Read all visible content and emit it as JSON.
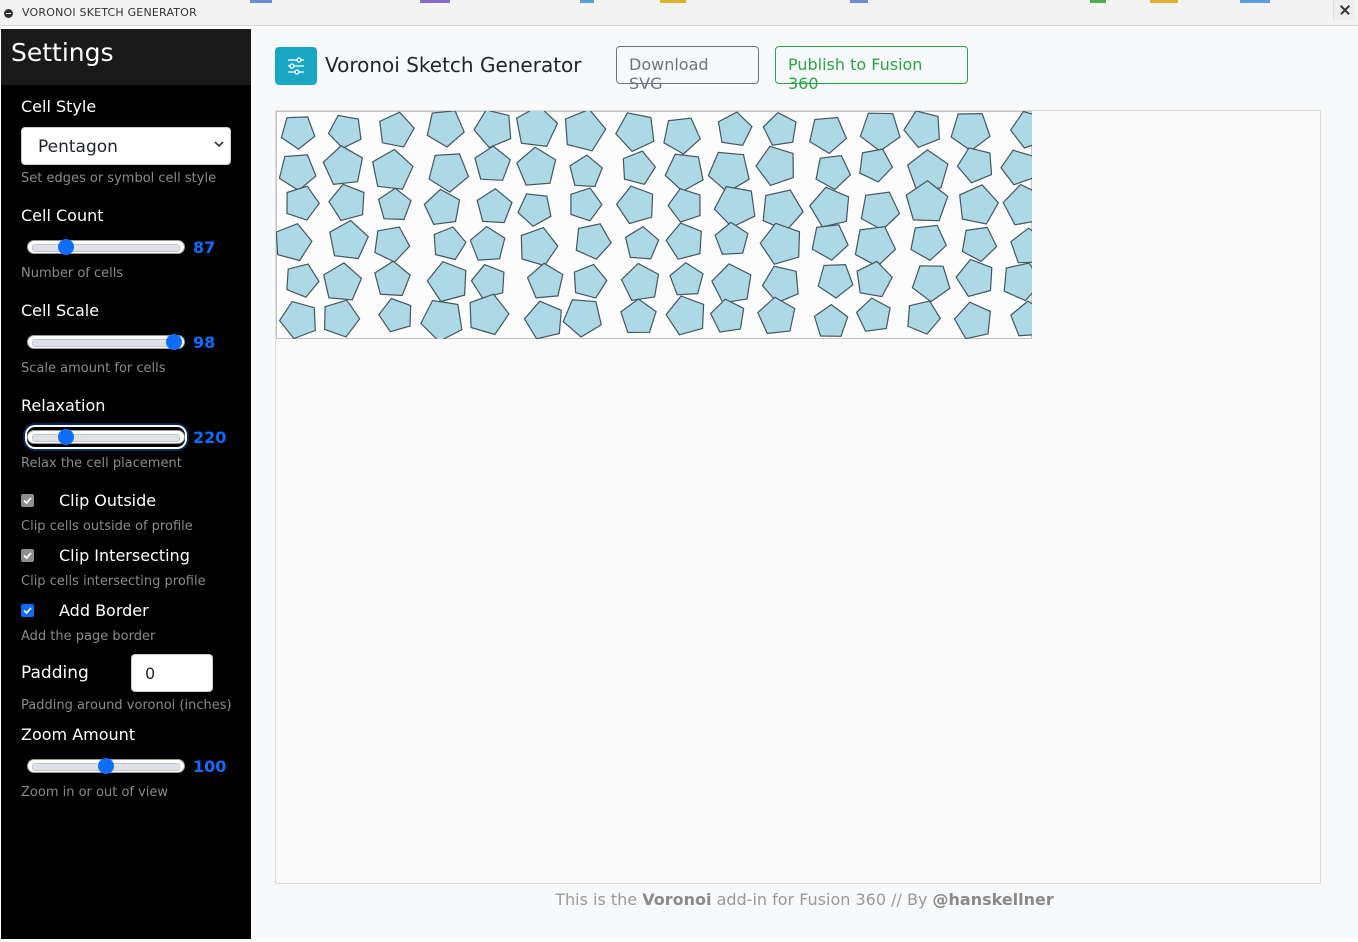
{
  "window": {
    "title": "VORONOI SKETCH GENERATOR"
  },
  "sidebar": {
    "title": "Settings",
    "cell_style": {
      "label": "Cell Style",
      "value": "Pentagon",
      "help": "Set edges or symbol cell style"
    },
    "cell_count": {
      "label": "Cell Count",
      "value": "87",
      "fraction": 0.22,
      "help": "Number of cells"
    },
    "cell_scale": {
      "label": "Cell Scale",
      "value": "98",
      "fraction": 0.98,
      "help": "Scale amount for cells"
    },
    "relaxation": {
      "label": "Relaxation",
      "value": "220",
      "fraction": 0.22,
      "help": "Relax the cell placement"
    },
    "clip_outside": {
      "label": "Clip Outside",
      "checked": true,
      "enabled": false,
      "help": "Clip cells outside of profile"
    },
    "clip_intersecting": {
      "label": "Clip Intersecting",
      "checked": true,
      "enabled": false,
      "help": "Clip cells intersecting profile"
    },
    "add_border": {
      "label": "Add Border",
      "checked": true,
      "enabled": true,
      "help": "Add the page border"
    },
    "padding": {
      "label": "Padding",
      "value": "0",
      "help": "Padding around voronoi (inches)"
    },
    "zoom": {
      "label": "Zoom Amount",
      "value": "100",
      "fraction": 0.5,
      "help": "Zoom in or out of view"
    }
  },
  "header": {
    "title": "Voronoi Sketch Generator",
    "download_label": "Download SVG",
    "publish_label": "Publish to Fusion 360"
  },
  "footer": {
    "prefix": "This is the",
    "product": "Voronoi",
    "middle": "add-in for Fusion 360 // By",
    "author": "@hanskellner"
  },
  "colors": {
    "sidebar_bg": "#000000",
    "accent": "#0d6efd",
    "cell_fill": "#add8e6",
    "cell_stroke": "#44575f",
    "app_icon": "#1aa7c4",
    "publish": "#28a745"
  },
  "icons": {
    "app": "sliders-icon",
    "select": "chevron-down-icon",
    "window": "app-window-icon",
    "close": "close-icon"
  }
}
